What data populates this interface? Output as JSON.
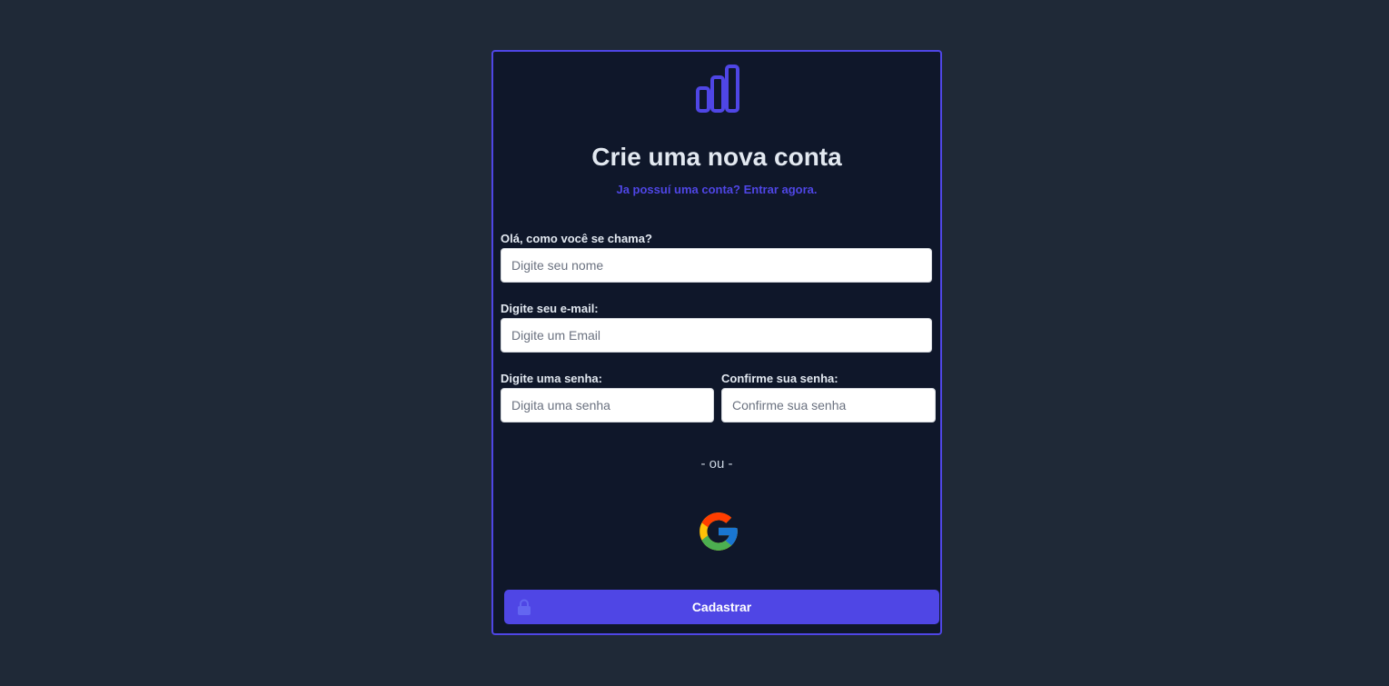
{
  "header": {
    "title": "Crie uma nova conta",
    "signin_link": "Ja possuí uma conta? Entrar agora."
  },
  "form": {
    "name": {
      "label": "Olá, como você se chama?",
      "placeholder": "Digite seu nome",
      "value": ""
    },
    "email": {
      "label": "Digite seu e-mail:",
      "placeholder": "Digite um Email",
      "value": ""
    },
    "password": {
      "label": "Digite uma senha:",
      "placeholder": "Digita uma senha",
      "value": ""
    },
    "confirm_password": {
      "label": "Confirme sua senha:",
      "placeholder": "Confirme sua senha",
      "value": ""
    },
    "divider": "- ou -",
    "submit_label": "Cadastrar"
  },
  "icons": {
    "logo": "bar-chart-icon",
    "google": "google-icon",
    "lock": "lock-icon"
  },
  "colors": {
    "background": "#1f2937",
    "card": "#0f172a",
    "accent": "#4f46e5",
    "text": "#e2e8f0"
  }
}
